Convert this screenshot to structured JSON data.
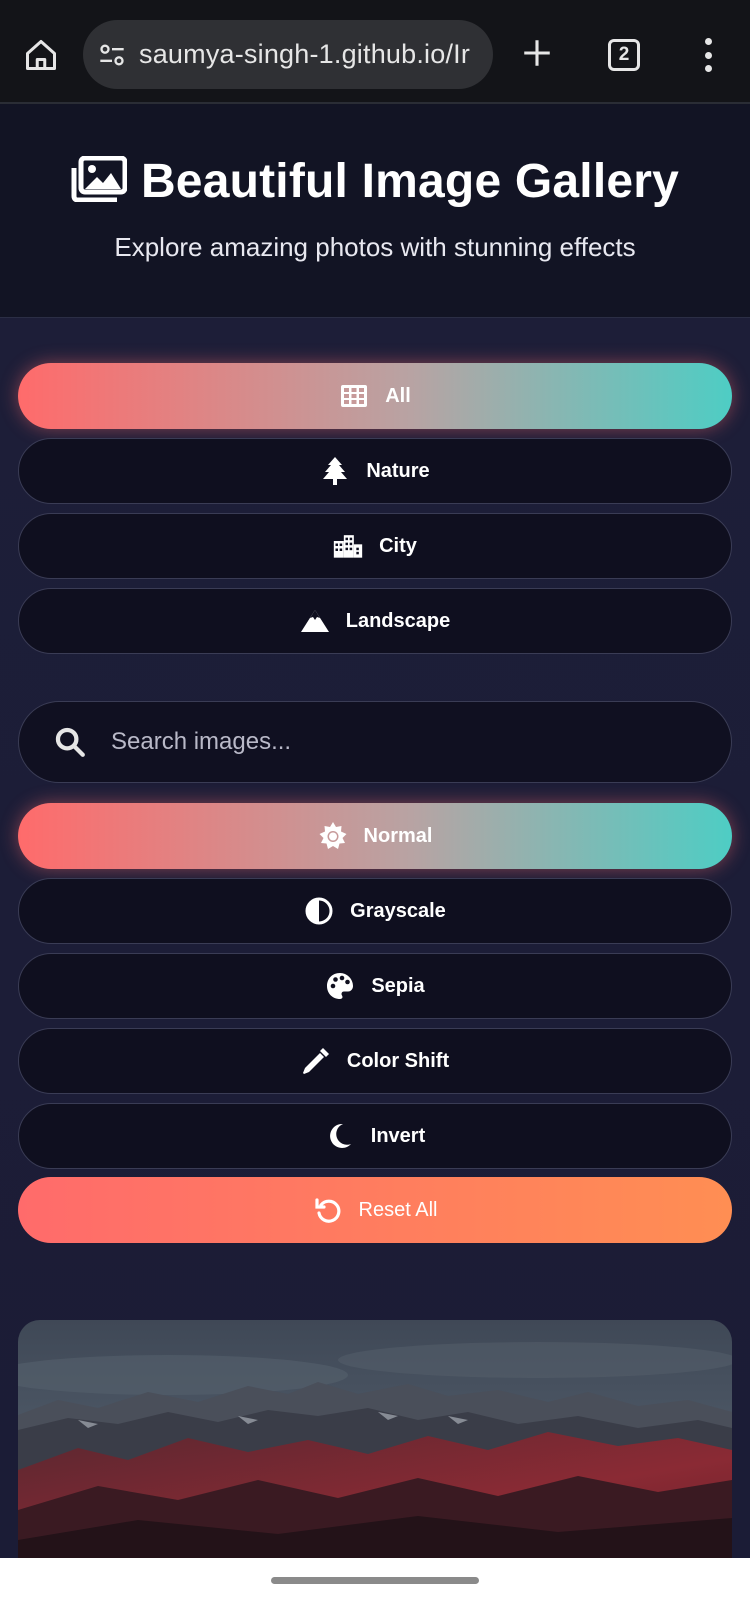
{
  "browser": {
    "url": "saumya-singh-1.github.io/Ir",
    "tab_count": "2",
    "icons": [
      "home-icon",
      "site-settings-icon",
      "new-tab-icon",
      "tab-switcher-icon",
      "overflow-menu-icon"
    ]
  },
  "header": {
    "title": "Beautiful Image Gallery",
    "subtitle": "Explore amazing photos with stunning effects",
    "icon": "images-icon"
  },
  "filters": [
    {
      "label": "All",
      "icon": "grid-icon",
      "active": true
    },
    {
      "label": "Nature",
      "icon": "tree-icon",
      "active": false
    },
    {
      "label": "City",
      "icon": "city-icon",
      "active": false
    },
    {
      "label": "Landscape",
      "icon": "mountain-icon",
      "active": false
    }
  ],
  "search": {
    "placeholder": "Search images...",
    "value": "",
    "icon": "search-icon"
  },
  "effects": [
    {
      "label": "Normal",
      "icon": "sun-icon",
      "active": true
    },
    {
      "label": "Grayscale",
      "icon": "adjust-icon",
      "active": false
    },
    {
      "label": "Sepia",
      "icon": "palette-icon",
      "active": false
    },
    {
      "label": "Color Shift",
      "icon": "eyedropper-icon",
      "active": false
    },
    {
      "label": "Invert",
      "icon": "moon-icon",
      "active": false
    }
  ],
  "reset": {
    "label": "Reset All",
    "icon": "undo-icon"
  },
  "colors": {
    "accent_start": "#ff6b6b",
    "accent_end": "#4ecdc4",
    "reset_end": "#ff8e53",
    "background": "#1b1b33",
    "header_bg": "#121424"
  }
}
